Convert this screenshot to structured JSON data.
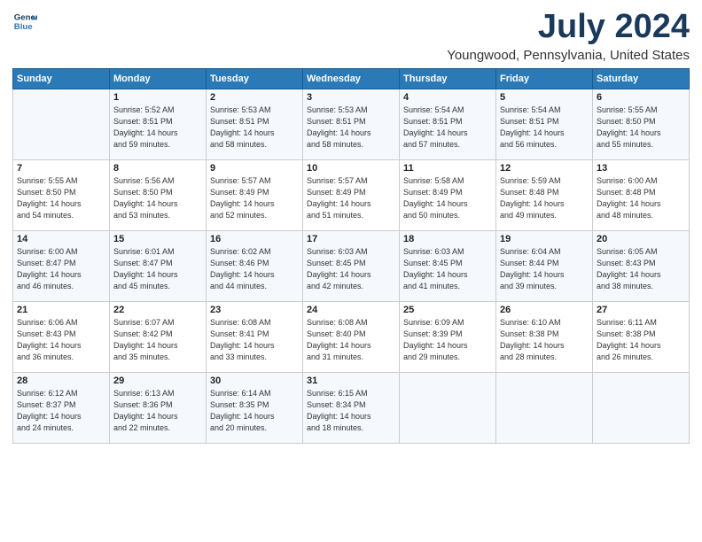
{
  "header": {
    "logo_line1": "General",
    "logo_line2": "Blue",
    "title": "July 2024",
    "subtitle": "Youngwood, Pennsylvania, United States"
  },
  "weekdays": [
    "Sunday",
    "Monday",
    "Tuesday",
    "Wednesday",
    "Thursday",
    "Friday",
    "Saturday"
  ],
  "weeks": [
    [
      {
        "day": "",
        "info": ""
      },
      {
        "day": "1",
        "info": "Sunrise: 5:52 AM\nSunset: 8:51 PM\nDaylight: 14 hours\nand 59 minutes."
      },
      {
        "day": "2",
        "info": "Sunrise: 5:53 AM\nSunset: 8:51 PM\nDaylight: 14 hours\nand 58 minutes."
      },
      {
        "day": "3",
        "info": "Sunrise: 5:53 AM\nSunset: 8:51 PM\nDaylight: 14 hours\nand 58 minutes."
      },
      {
        "day": "4",
        "info": "Sunrise: 5:54 AM\nSunset: 8:51 PM\nDaylight: 14 hours\nand 57 minutes."
      },
      {
        "day": "5",
        "info": "Sunrise: 5:54 AM\nSunset: 8:51 PM\nDaylight: 14 hours\nand 56 minutes."
      },
      {
        "day": "6",
        "info": "Sunrise: 5:55 AM\nSunset: 8:50 PM\nDaylight: 14 hours\nand 55 minutes."
      }
    ],
    [
      {
        "day": "7",
        "info": "Sunrise: 5:55 AM\nSunset: 8:50 PM\nDaylight: 14 hours\nand 54 minutes."
      },
      {
        "day": "8",
        "info": "Sunrise: 5:56 AM\nSunset: 8:50 PM\nDaylight: 14 hours\nand 53 minutes."
      },
      {
        "day": "9",
        "info": "Sunrise: 5:57 AM\nSunset: 8:49 PM\nDaylight: 14 hours\nand 52 minutes."
      },
      {
        "day": "10",
        "info": "Sunrise: 5:57 AM\nSunset: 8:49 PM\nDaylight: 14 hours\nand 51 minutes."
      },
      {
        "day": "11",
        "info": "Sunrise: 5:58 AM\nSunset: 8:49 PM\nDaylight: 14 hours\nand 50 minutes."
      },
      {
        "day": "12",
        "info": "Sunrise: 5:59 AM\nSunset: 8:48 PM\nDaylight: 14 hours\nand 49 minutes."
      },
      {
        "day": "13",
        "info": "Sunrise: 6:00 AM\nSunset: 8:48 PM\nDaylight: 14 hours\nand 48 minutes."
      }
    ],
    [
      {
        "day": "14",
        "info": "Sunrise: 6:00 AM\nSunset: 8:47 PM\nDaylight: 14 hours\nand 46 minutes."
      },
      {
        "day": "15",
        "info": "Sunrise: 6:01 AM\nSunset: 8:47 PM\nDaylight: 14 hours\nand 45 minutes."
      },
      {
        "day": "16",
        "info": "Sunrise: 6:02 AM\nSunset: 8:46 PM\nDaylight: 14 hours\nand 44 minutes."
      },
      {
        "day": "17",
        "info": "Sunrise: 6:03 AM\nSunset: 8:45 PM\nDaylight: 14 hours\nand 42 minutes."
      },
      {
        "day": "18",
        "info": "Sunrise: 6:03 AM\nSunset: 8:45 PM\nDaylight: 14 hours\nand 41 minutes."
      },
      {
        "day": "19",
        "info": "Sunrise: 6:04 AM\nSunset: 8:44 PM\nDaylight: 14 hours\nand 39 minutes."
      },
      {
        "day": "20",
        "info": "Sunrise: 6:05 AM\nSunset: 8:43 PM\nDaylight: 14 hours\nand 38 minutes."
      }
    ],
    [
      {
        "day": "21",
        "info": "Sunrise: 6:06 AM\nSunset: 8:43 PM\nDaylight: 14 hours\nand 36 minutes."
      },
      {
        "day": "22",
        "info": "Sunrise: 6:07 AM\nSunset: 8:42 PM\nDaylight: 14 hours\nand 35 minutes."
      },
      {
        "day": "23",
        "info": "Sunrise: 6:08 AM\nSunset: 8:41 PM\nDaylight: 14 hours\nand 33 minutes."
      },
      {
        "day": "24",
        "info": "Sunrise: 6:08 AM\nSunset: 8:40 PM\nDaylight: 14 hours\nand 31 minutes."
      },
      {
        "day": "25",
        "info": "Sunrise: 6:09 AM\nSunset: 8:39 PM\nDaylight: 14 hours\nand 29 minutes."
      },
      {
        "day": "26",
        "info": "Sunrise: 6:10 AM\nSunset: 8:38 PM\nDaylight: 14 hours\nand 28 minutes."
      },
      {
        "day": "27",
        "info": "Sunrise: 6:11 AM\nSunset: 8:38 PM\nDaylight: 14 hours\nand 26 minutes."
      }
    ],
    [
      {
        "day": "28",
        "info": "Sunrise: 6:12 AM\nSunset: 8:37 PM\nDaylight: 14 hours\nand 24 minutes."
      },
      {
        "day": "29",
        "info": "Sunrise: 6:13 AM\nSunset: 8:36 PM\nDaylight: 14 hours\nand 22 minutes."
      },
      {
        "day": "30",
        "info": "Sunrise: 6:14 AM\nSunset: 8:35 PM\nDaylight: 14 hours\nand 20 minutes."
      },
      {
        "day": "31",
        "info": "Sunrise: 6:15 AM\nSunset: 8:34 PM\nDaylight: 14 hours\nand 18 minutes."
      },
      {
        "day": "",
        "info": ""
      },
      {
        "day": "",
        "info": ""
      },
      {
        "day": "",
        "info": ""
      }
    ]
  ]
}
